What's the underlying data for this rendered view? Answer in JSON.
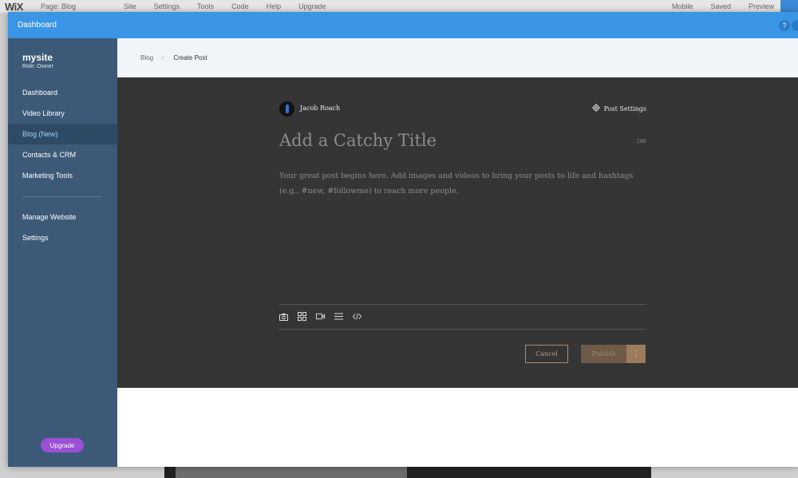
{
  "background": {
    "logo": "WiX",
    "page_label": "Page: Blog",
    "menu": [
      "Site",
      "Settings",
      "Tools",
      "Code",
      "Help",
      "Upgrade"
    ],
    "right_items": [
      "Mobile",
      "Saved",
      "Preview"
    ]
  },
  "modal": {
    "title": "Dashboard",
    "help_label": "?"
  },
  "sidebar": {
    "site_name": "mysite",
    "role": "Role: Owner",
    "items": [
      {
        "label": "Dashboard"
      },
      {
        "label": "Video Library"
      },
      {
        "label": "Blog (New)"
      },
      {
        "label": "Contacts & CRM"
      },
      {
        "label": "Marketing Tools"
      },
      {
        "label": "Manage Website"
      },
      {
        "label": "Settings"
      }
    ],
    "upgrade_label": "Upgrade"
  },
  "breadcrumb": {
    "parent": "Blog",
    "current": "Create Post"
  },
  "editor": {
    "author": "Jacob Roach",
    "post_settings_label": "Post Settings",
    "title_placeholder": "Add a Catchy Title",
    "char_count": "100",
    "body_placeholder": "Your great post begins here. Add images and videos to bring your posts to life and hashtags (e.g., #new, #followme) to reach more people.",
    "toolbar_icons": [
      "camera-icon",
      "gallery-icon",
      "video-icon",
      "divider-icon",
      "code-icon"
    ],
    "cancel_label": "Cancel",
    "publish_label": "Publish",
    "more_label": "⋮"
  }
}
